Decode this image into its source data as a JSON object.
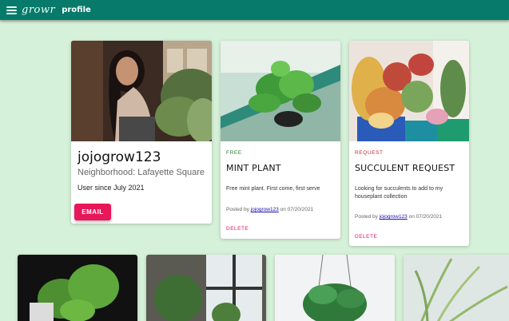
{
  "appbar": {
    "brand": "growr",
    "page_title": "profile"
  },
  "profile": {
    "username": "jojogrow123",
    "neighborhood": "Neighborhood: Lafayette Square",
    "member_since": "User since July 2021",
    "email_label": "EMAIL"
  },
  "posts": [
    {
      "tag": "FREE",
      "title": "MINT PLANT",
      "description": "Free mint plant. First come, first serve",
      "posted_prefix": "Posted by",
      "author": "jojogrow123",
      "posted_suffix": "on 07/20/2021",
      "delete_label": "DELETE"
    },
    {
      "tag": "REQUEST",
      "title": "SUCCULENT REQUEST",
      "description": "Looking for succulents to add to my houseplant collection",
      "posted_prefix": "Posted by",
      "author": "jojogrow123",
      "posted_suffix": "on 07/20/2021",
      "delete_label": "DELETE"
    }
  ],
  "colors": {
    "appbar": "#077a6b",
    "background": "#d6f1d9",
    "accent": "#e8175a"
  }
}
